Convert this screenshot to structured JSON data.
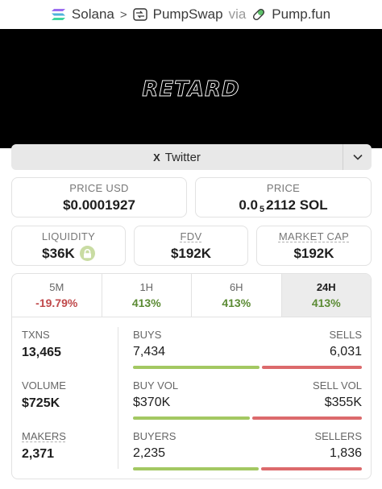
{
  "breadcrumb": {
    "chain": "Solana",
    "dex": "PumpSwap",
    "via": "via",
    "launchpad": "Pump.fun"
  },
  "banner": {
    "logo_text": "RETARD"
  },
  "social": {
    "twitter_label": "Twitter"
  },
  "price": {
    "usd_label": "PRICE USD",
    "usd_value": "$0.0001927",
    "native_label": "PRICE",
    "native_prefix": "0.0",
    "native_sub": "5",
    "native_rest": "2112 SOL"
  },
  "metrics": {
    "liquidity_label": "LIQUIDITY",
    "liquidity_value": "$36K",
    "fdv_label": "FDV",
    "fdv_value": "$192K",
    "mcap_label": "MARKET CAP",
    "mcap_value": "$192K"
  },
  "timeframes": [
    {
      "label": "5M",
      "change": "-19.79%",
      "trend": "down"
    },
    {
      "label": "1H",
      "change": "413%",
      "trend": "up"
    },
    {
      "label": "6H",
      "change": "413%",
      "trend": "up"
    },
    {
      "label": "24H",
      "change": "413%",
      "trend": "up",
      "active": true
    }
  ],
  "stats": {
    "txns_label": "TXNS",
    "txns_value": "13,465",
    "volume_label": "VOLUME",
    "volume_value": "$725K",
    "makers_label": "MAKERS",
    "makers_value": "2,371",
    "buys_label": "BUYS",
    "buys_value": "7,434",
    "sells_label": "SELLS",
    "sells_value": "6,031",
    "buyvol_label": "BUY VOL",
    "buyvol_value": "$370K",
    "sellvol_label": "SELL VOL",
    "sellvol_value": "$355K",
    "buyers_label": "BUYERS",
    "buyers_value": "2,235",
    "sellers_label": "SELLERS",
    "sellers_value": "1,836",
    "buys_ratio": 0.552,
    "buyvol_ratio": 0.51,
    "buyers_ratio": 0.549
  },
  "colors": {
    "positive": "#5b8b34",
    "negative": "#c0494b",
    "buy_bar": "#a3c862",
    "sell_bar": "#dc6a6c"
  }
}
